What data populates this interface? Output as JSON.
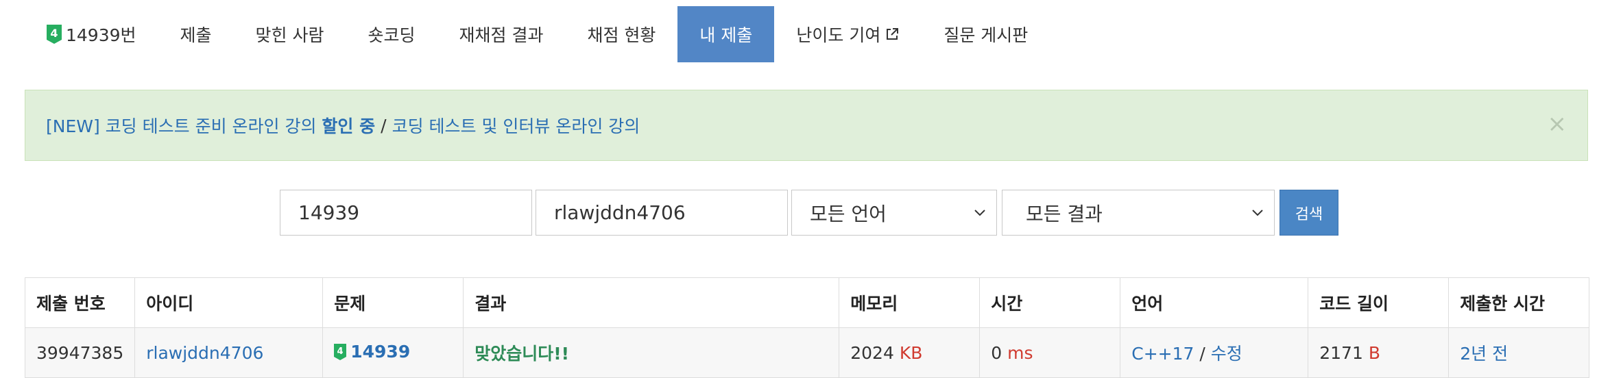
{
  "nav": {
    "problem_number": "14939번",
    "problem_level": "4",
    "items": [
      "제출",
      "맞힌 사람",
      "숏코딩",
      "재채점 결과",
      "채점 현황",
      "내 제출",
      "난이도 기여",
      "질문 게시판"
    ],
    "active_index": 5
  },
  "alert": {
    "part1": "[NEW] 코딩 테스트 준비 온라인 강의 ",
    "part1_bold": "할인 중",
    "separator": "/",
    "part2": "코딩 테스트 및 인터뷰 온라인 강의",
    "close": "×"
  },
  "search": {
    "problem_id": "14939",
    "user_id": "rlawjddn4706",
    "language": "모든 언어",
    "result": "모든 결과",
    "button": "검색"
  },
  "table": {
    "headers": [
      "제출 번호",
      "아이디",
      "문제",
      "결과",
      "메모리",
      "시간",
      "언어",
      "코드 길이",
      "제출한 시간"
    ],
    "rows": [
      {
        "submission_id": "39947385",
        "user_id": "rlawjddn4706",
        "problem_level": "4",
        "problem_id": "14939",
        "result": "맞았습니다!!",
        "memory": "2024",
        "memory_unit": "KB",
        "time": "0",
        "time_unit": "ms",
        "language": "C++17",
        "lang_sep": "/",
        "edit": "수정",
        "code_length": "2171",
        "code_unit": "B",
        "submitted": "2년 전"
      }
    ]
  },
  "colors": {
    "active_tab": "#5286c6",
    "level_badge": "#27ae60",
    "link": "#2a6eb3",
    "unit": "#d03a2f",
    "accepted": "#2e8b57",
    "alert_bg": "#e0efda"
  }
}
